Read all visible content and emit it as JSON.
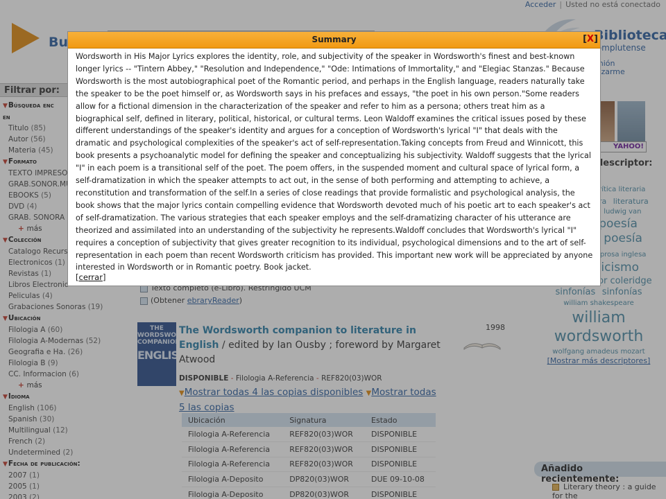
{
  "topbar": {
    "login": "Acceder",
    "separator": "|",
    "status": "Usted no está conectado"
  },
  "search": {
    "brand": "Bu"
  },
  "library": {
    "name": "Biblioteca",
    "subtitle": "d Complutense",
    "opinion_line1": "opinión",
    "opinion_line2": "utilizarme"
  },
  "filters": {
    "header": "Filtrar por:",
    "groups": [
      {
        "title": "Búsqueda enc",
        "title2": "en",
        "items": [
          {
            "label": "Titulo",
            "count": "(85)"
          },
          {
            "label": "Autor",
            "count": "(56)"
          },
          {
            "label": "Materia",
            "count": "(45)"
          }
        ],
        "more": ""
      },
      {
        "title": "Formato",
        "items": [
          {
            "label": "TEXTO IMPRESO",
            "count": "("
          },
          {
            "label": "GRAB.SONOR.MUS",
            "count": ""
          },
          {
            "label": "EBOOKS",
            "count": "(5)"
          },
          {
            "label": "DVD",
            "count": "(4)"
          },
          {
            "label": "GRAB. SONORA",
            "count": "(1)"
          }
        ],
        "more": "más"
      },
      {
        "title": "Colección",
        "items": [
          {
            "label": "Catalogo Recurso",
            "count": ""
          },
          {
            "label": "Electronicos",
            "count": "(1)"
          },
          {
            "label": "Revistas",
            "count": "(1)"
          },
          {
            "label": "Libros Electronic",
            "count": ""
          },
          {
            "label": "Peliculas",
            "count": "(4)"
          },
          {
            "label": "Grabaciones Sonoras",
            "count": "(19)"
          }
        ],
        "more": ""
      },
      {
        "title": "Ubicación",
        "items": [
          {
            "label": "Filologia A",
            "count": "(60)"
          },
          {
            "label": "Filologia A-Modernas",
            "count": "(52)"
          },
          {
            "label": "Geografia e Ha.",
            "count": "(26)"
          },
          {
            "label": "Filologia B",
            "count": "(9)"
          },
          {
            "label": "CC. Informacion",
            "count": "(6)"
          }
        ],
        "more": "más"
      },
      {
        "title": "Idioma",
        "items": [
          {
            "label": "English",
            "count": "(106)"
          },
          {
            "label": "Spanish",
            "count": "(30)"
          },
          {
            "label": "Multilingual",
            "count": "(12)"
          },
          {
            "label": "French",
            "count": "(2)"
          },
          {
            "label": "Undetermined",
            "count": "(2)"
          }
        ],
        "more": ""
      },
      {
        "title": "Fecha de publicación:",
        "items": [
          {
            "label": "2007",
            "count": "(1)"
          },
          {
            "label": "2005",
            "count": "(1)"
          },
          {
            "label": "2003",
            "count": "(2)"
          }
        ],
        "more": ""
      }
    ]
  },
  "right": {
    "yahoo": "YAHOO!",
    "descriptor_header": "descriptor:",
    "tags": [
      {
        "text": "ismo",
        "size": "t-xl"
      },
      {
        "text": "crítica literaria",
        "size": "t-xs"
      },
      {
        "text": "haydn",
        "size": "t-xs"
      },
      {
        "text": "john",
        "size": "t-xs"
      },
      {
        "text": "ra",
        "size": "t-s"
      },
      {
        "text": "literatura",
        "size": "t-s"
      },
      {
        "text": "iteratura",
        "size": "t-xs"
      },
      {
        "text": "a",
        "size": "t-xs"
      },
      {
        "text": "ludwig van",
        "size": "t-xs"
      },
      {
        "text": "piotr ilich",
        "size": "t-xs"
      },
      {
        "text": "poesía",
        "size": "t-l"
      },
      {
        "text": "inglesa",
        "size": "t-l"
      },
      {
        "text": "poesía",
        "size": "t-l"
      },
      {
        "text": "inglesa",
        "size": "t-l"
      },
      {
        "text": "prosa inglesa",
        "size": "t-xs"
      },
      {
        "text": "romanticismo",
        "size": "t-l"
      },
      {
        "text": "samuel taylor coleridge",
        "size": "t-m"
      },
      {
        "text": "sinfonías",
        "size": "t-m"
      },
      {
        "text": "sinfonías",
        "size": "t-m"
      },
      {
        "text": "william shakespeare",
        "size": "t-xs"
      },
      {
        "text": "william",
        "size": "t-xl"
      },
      {
        "text": "wordsworth",
        "size": "t-xl"
      },
      {
        "text": "wolfgang amadeus mozart",
        "size": "t-xs"
      }
    ],
    "more_descriptors": "[Mostrar más descriptores]",
    "recent_header": "Añadido recientemente:",
    "recent_item": "Literary theory : a guide for the"
  },
  "results": {
    "prev_line1": "Texto completo (e-Libro). Restringido UCM",
    "prev_line2_prefix": "(Obtener ",
    "prev_line2_link": "ebraryReader",
    "prev_line2_suffix": ")",
    "book": {
      "cover_top": "THE WORDSWORTH COMPANION",
      "cover_big": "ENGLISH",
      "title": "The Wordsworth companion to literature in English",
      "responsibility": " / edited by Ian Ousby ; foreword by Margaret Atwood",
      "year": "1998",
      "status": "DISPONIBLE",
      "dash": " - ",
      "location": "Filologia A-Referencia",
      "callnumber": "REF820(03)WOR",
      "show_available": "Mostrar todas 4 las copias disponibles",
      "show_all": "Mostrar todas 5 las copias"
    },
    "table": {
      "headers": [
        "Ubicación",
        "Signatura",
        "Estado"
      ],
      "rows": [
        [
          "Filologia A-Referencia",
          "REF820(03)WOR",
          "DISPONIBLE"
        ],
        [
          "Filologia A-Referencia",
          "REF820(03)WOR",
          "DISPONIBLE"
        ],
        [
          "Filologia A-Referencia",
          "REF820(03)WOR",
          "DISPONIBLE"
        ],
        [
          "Filologia A-Deposito",
          "DP820(03)WOR",
          "DUE 09-10-08"
        ],
        [
          "Filologia A-Deposito",
          "DP820(03)WOR",
          "DISPONIBLE"
        ]
      ]
    }
  },
  "modal": {
    "title": "Summary",
    "close_open": "[",
    "close_x": "X",
    "close_end": "]",
    "body": "Wordsworth in His Major Lyrics explores the identity, role, and subjectivity of the speaker in Wordsworth's finest and best-known longer lyrics -- \"Tintern Abbey,\" \"Resolution and Independence,\" \"Ode: Intimations of Immortality,\" and \"Elegiac Stanzas.\" Because Wordsworth is the most autobiographical poet of the Romantic period, and perhaps in the English language, readers naturally take the speaker to be the poet himself or, as Wordsworth says in his prefaces and essays, \"the poet in his own person.\"Some readers allow for a fictional dimension in the characterization of the speaker and refer to him as a persona; others treat him as a biographical self, defined in literary, political, historical, or cultural terms. Leon Waldoff examines the critical issues posed by these different understandings of the speaker's identity and argues for a conception of Wordsworth's lyrical \"I\" that deals with the dramatic and psychological complexities of the speaker's act of self-representation.Taking concepts from Freud and Winnicott, this book presents a psychoanalytic model for defining the speaker and conceptualizing his subjectivity. Waldoff suggests that the lyrical \"I\" in each poem is a transitional self of the poet. The poem offers, in the suspended moment and cultural space of lyrical form, a self-dramatization in which the speaker attempts to act out, in the sense of both performing and attempting to achieve, a reconstitution and transformation of the self.In a series of close readings that provide formalistic and psychological analysis, the book shows that the major lyrics contain compelling evidence that Wordsworth devoted much of his poetic art to each speaker's act of self-dramatization. The various strategies that each speaker employs and the self-dramatizing character of his utterance are theorized and assimilated into an understanding of the subjectivity he represents.Waldoff concludes that Wordsworth's lyrical \"I\" requires a conception of subjectivity that gives greater recognition to its individual, psychological dimensions and to the art of self-representation in each poem than recent Wordsworth criticism has provided. This important new work will be appreciated by anyone interested in Wordsworth or in Romantic poetry. Book jacket.",
    "close_link_open": "[",
    "close_link": "cerrar",
    "close_link_end": "]"
  },
  "colors": {
    "accent": "#f19a12",
    "link": "#2b5fa0",
    "tag": "#4a8aa5",
    "overlay": "rgba(60,60,60,0.42)"
  }
}
